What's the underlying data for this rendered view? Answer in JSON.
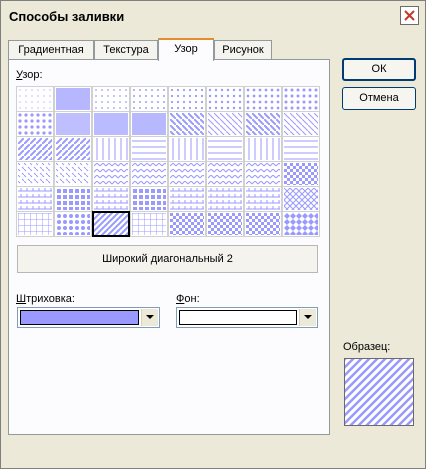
{
  "window": {
    "title": "Способы заливки"
  },
  "tabs": [
    {
      "label": "Градиентная",
      "active": false
    },
    {
      "label": "Текстура",
      "active": false
    },
    {
      "label": "Узор",
      "active": true
    },
    {
      "label": "Рисунок",
      "active": false
    }
  ],
  "pattern_section": {
    "label_underlined": "У",
    "label_rest": "зор:",
    "selected_name": "Широкий диагональный 2",
    "patterns": [
      "dots-5",
      "dots-10",
      "dots-20",
      "dots-25",
      "dots-30",
      "dots-40",
      "dots-50",
      "dots-60",
      "dots-70",
      "dots-75",
      "dots-80",
      "dots-90",
      "light-down-diag",
      "light-up-diag",
      "dark-down-diag",
      "dark-up-diag",
      "wide-down-diag",
      "wide-up-diag",
      "light-vert",
      "light-horiz",
      "narrow-vert",
      "narrow-horiz",
      "dark-vert",
      "dark-horiz",
      "dashed-down-diag",
      "dashed-up-diag",
      "dashed-horiz",
      "dashed-vert",
      "small-confetti",
      "large-confetti",
      "zigzag",
      "wave",
      "diag-brick",
      "horiz-brick",
      "weave",
      "plaid",
      "divot",
      "dotted-grid",
      "dotted-diamond",
      "shingle",
      "trellis",
      "sphere",
      "small-grid",
      "large-grid",
      "small-checker",
      "large-checker",
      "outlined-diamond",
      "solid-diamond"
    ],
    "selected_index": 42
  },
  "foreground": {
    "label_underlined": "Ш",
    "label_rest": "триховка:",
    "color": "#9999ff"
  },
  "background": {
    "label_underlined": "Ф",
    "label_rest": "он:",
    "color": "#ffffff"
  },
  "buttons": {
    "ok": "ОК",
    "cancel": "Отмена"
  },
  "sample": {
    "label": "Образец:"
  },
  "colors": {
    "pattern_fg": "#9999ff",
    "pattern_bg": "#ffffff",
    "tab_highlight": "#e68b2c"
  }
}
